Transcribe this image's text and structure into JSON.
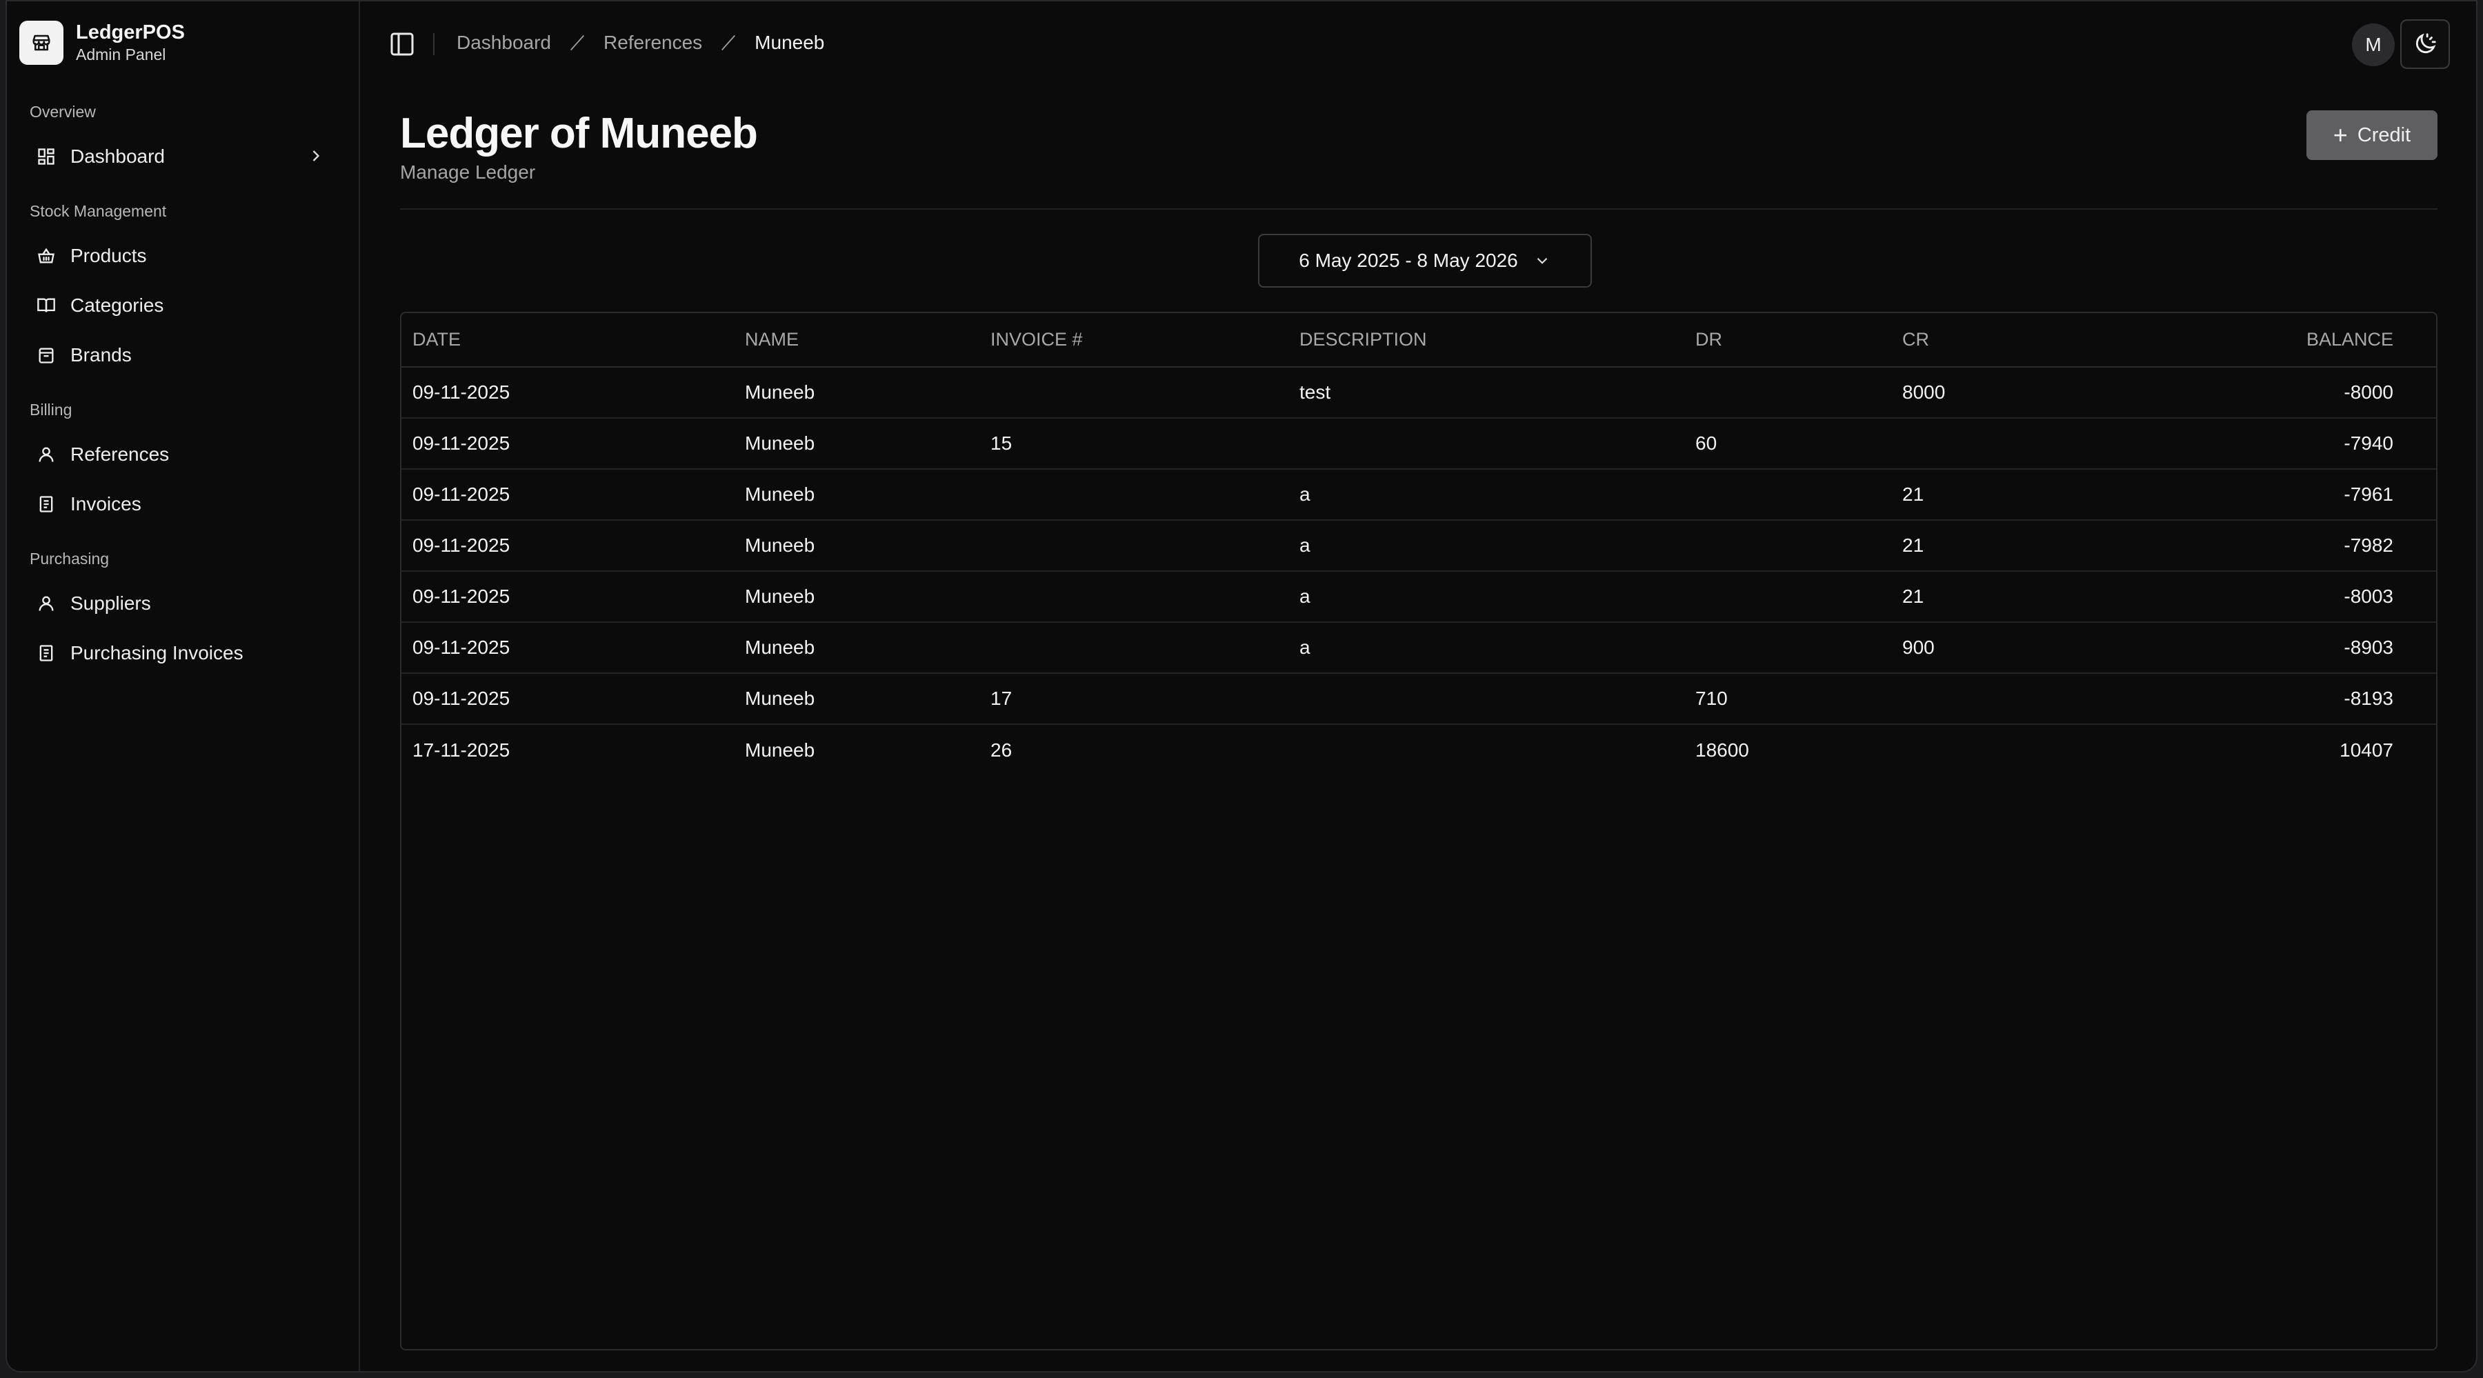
{
  "brand": {
    "name": "LedgerPOS",
    "subtitle": "Admin Panel"
  },
  "sidebar": {
    "groups": [
      {
        "label": "Overview",
        "items": [
          {
            "label": "Dashboard",
            "icon": "layout-grid-icon",
            "has_chevron": true
          }
        ]
      },
      {
        "label": "Stock Management",
        "items": [
          {
            "label": "Products",
            "icon": "basket-icon"
          },
          {
            "label": "Categories",
            "icon": "book-open-icon"
          },
          {
            "label": "Brands",
            "icon": "package-icon"
          }
        ]
      },
      {
        "label": "Billing",
        "items": [
          {
            "label": "References",
            "icon": "user-icon"
          },
          {
            "label": "Invoices",
            "icon": "receipt-icon"
          }
        ]
      },
      {
        "label": "Purchasing",
        "items": [
          {
            "label": "Suppliers",
            "icon": "user-icon"
          },
          {
            "label": "Purchasing Invoices",
            "icon": "receipt-icon"
          }
        ]
      }
    ]
  },
  "header": {
    "breadcrumbs": [
      "Dashboard",
      "References",
      "Muneeb"
    ],
    "avatar_initial": "M"
  },
  "page": {
    "title": "Ledger of Muneeb",
    "subtitle": "Manage Ledger",
    "credit_button": "Credit",
    "date_range": "6 May 2025 - 8 May 2026"
  },
  "table": {
    "columns": [
      "DATE",
      "NAME",
      "INVOICE #",
      "DESCRIPTION",
      "DR",
      "CR",
      "BALANCE"
    ],
    "rows": [
      [
        "09-11-2025",
        "Muneeb",
        "",
        "test",
        "",
        "8000",
        "-8000"
      ],
      [
        "09-11-2025",
        "Muneeb",
        "15",
        "",
        "60",
        "",
        "-7940"
      ],
      [
        "09-11-2025",
        "Muneeb",
        "",
        "a",
        "",
        "21",
        "-7961"
      ],
      [
        "09-11-2025",
        "Muneeb",
        "",
        "a",
        "",
        "21",
        "-7982"
      ],
      [
        "09-11-2025",
        "Muneeb",
        "",
        "a",
        "",
        "21",
        "-8003"
      ],
      [
        "09-11-2025",
        "Muneeb",
        "",
        "a",
        "",
        "900",
        "-8903"
      ],
      [
        "09-11-2025",
        "Muneeb",
        "17",
        "",
        "710",
        "",
        "-8193"
      ],
      [
        "17-11-2025",
        "Muneeb",
        "26",
        "",
        "18600",
        "",
        "10407"
      ]
    ]
  },
  "colors": {
    "background": "#0b0b0b",
    "accent_button": "#5f5f61",
    "border": "#2c2c2e"
  }
}
